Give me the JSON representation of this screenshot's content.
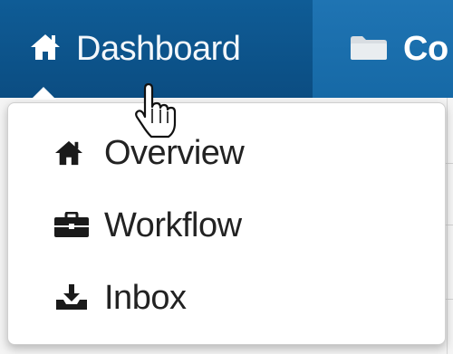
{
  "navbar": {
    "items": [
      {
        "label": "Dashboard",
        "icon": "home-icon"
      },
      {
        "label": "Co",
        "icon": "folder-icon"
      }
    ]
  },
  "dropdown": {
    "items": [
      {
        "label": "Overview",
        "icon": "home-icon"
      },
      {
        "label": "Workflow",
        "icon": "briefcase-icon"
      },
      {
        "label": "Inbox",
        "icon": "inbox-download-icon"
      }
    ]
  },
  "colors": {
    "navbar": "#0d4f84",
    "navbar_active": "#1f74b3",
    "menu_text": "#222222",
    "nav_text": "#f3f7fb"
  }
}
